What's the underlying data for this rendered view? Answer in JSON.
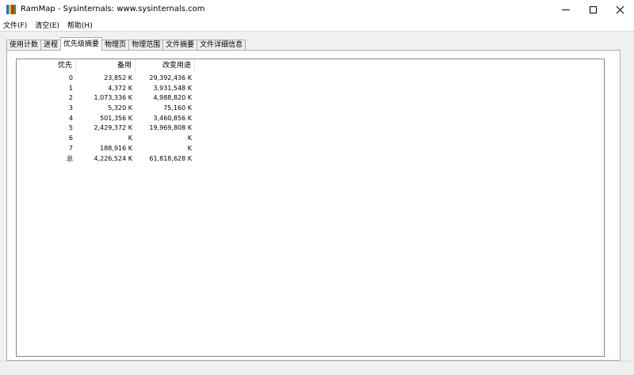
{
  "window": {
    "title": "RamMap - Sysinternals: www.sysinternals.com",
    "icon_colors": [
      "#1e6fd9",
      "#e8c21a",
      "#d9262b",
      "#2a9a3a"
    ]
  },
  "menu": [
    "文件(F)",
    "清空(E)",
    "帮助(H)"
  ],
  "tabs": [
    "使用计数",
    "进程",
    "优先级摘要",
    "物理页",
    "物理范围",
    "文件摘要",
    "文件详细信息"
  ],
  "active_tab": 2,
  "table": {
    "headers": [
      "优先",
      "备用",
      "改变用途"
    ],
    "rows": [
      [
        "0",
        "23,852 K",
        "29,392,436 K"
      ],
      [
        "1",
        "4,372 K",
        "3,931,548 K"
      ],
      [
        "2",
        "1,073,336 K",
        "4,988,820 K"
      ],
      [
        "3",
        "5,320 K",
        "75,160 K"
      ],
      [
        "4",
        "501,356 K",
        "3,460,856 K"
      ],
      [
        "5",
        "2,429,372 K",
        "19,969,808 K"
      ],
      [
        "6",
        "K",
        "K"
      ],
      [
        "7",
        "188,916 K",
        "K"
      ],
      [
        "总",
        "4,226,524 K",
        "61,818,628 K"
      ]
    ]
  }
}
